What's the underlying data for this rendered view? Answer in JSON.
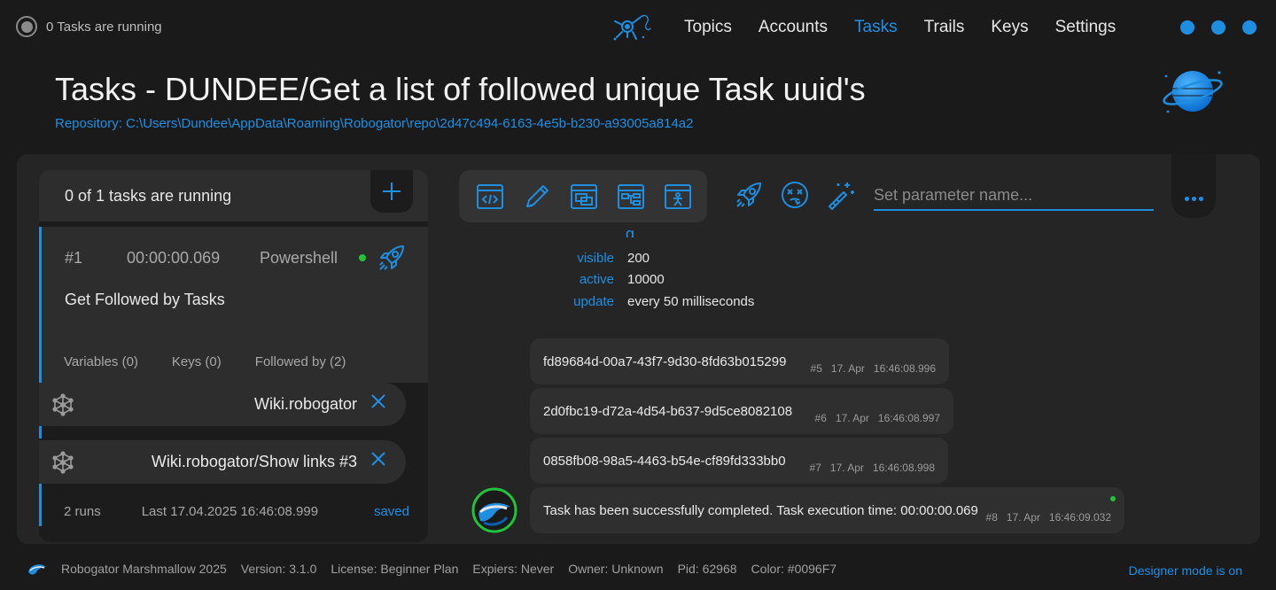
{
  "header": {
    "status_text": "0 Tasks are running",
    "nav": [
      "Topics",
      "Accounts",
      "Tasks",
      "Trails",
      "Keys",
      "Settings"
    ],
    "active_nav": "Tasks",
    "title": "Tasks - DUNDEE/Get a list of followed unique Task uuid's",
    "repository": "Repository: C:\\Users\\Dundee\\AppData\\Roaming\\Robogator\\repo\\2d47c494-6163-4e5b-b230-a93005a814a2"
  },
  "left_panel": {
    "running_text": "0 of 1 tasks are running",
    "task": {
      "number": "#1",
      "duration": "00:00:00.069",
      "type": "Powershell",
      "name": "Get Followed by Tasks",
      "variables": "Variables (0)",
      "keys": "Keys (0)",
      "followed_by": "Followed by (2)"
    },
    "followed": [
      {
        "label": "Wiki.robogator"
      },
      {
        "label": "Wiki.robogator/Show links #3"
      }
    ],
    "runs": "2 runs",
    "last_run": "Last 17.04.2025 16:46:08.999",
    "saved": "saved"
  },
  "toolbar": {
    "param_placeholder": "Set parameter name..."
  },
  "output": {
    "partial_glyph": "g",
    "stats": [
      {
        "key": "visible",
        "value": "200"
      },
      {
        "key": "active",
        "value": "10000"
      },
      {
        "key": "update",
        "value": "every 50 milliseconds"
      }
    ],
    "messages": [
      {
        "text": "fd89684d-00a7-43f7-9d30-8fd63b015299",
        "num": "#5",
        "date": "17. Apr",
        "time": "16:46:08.996"
      },
      {
        "text": "2d0fbc19-d72a-4d54-b637-9d5ce8082108",
        "num": "#6",
        "date": "17. Apr",
        "time": "16:46:08.997"
      },
      {
        "text": "0858fb08-98a5-4463-b54e-cf89fd333bb0",
        "num": "#7",
        "date": "17. Apr",
        "time": "16:46:08.998"
      },
      {
        "text": "Task has been successfully completed. Task execution time: 00:00:00.069",
        "num": "#8",
        "date": "17. Apr",
        "time": "16:46:09.032"
      }
    ]
  },
  "statusbar": {
    "app": "Robogator Marshmallow 2025",
    "version": "Version: 3.1.0",
    "license": "License: Beginner Plan",
    "expires": "Expiers: Never",
    "owner": "Owner: Unknown",
    "pid": "Pid: 62968",
    "color": "Color: #0096F7",
    "designer": "Designer mode is on"
  },
  "colors": {
    "accent": "#1e90e6",
    "background": "#1a1a1a",
    "panel": "#252525",
    "running": "#21c33a"
  }
}
